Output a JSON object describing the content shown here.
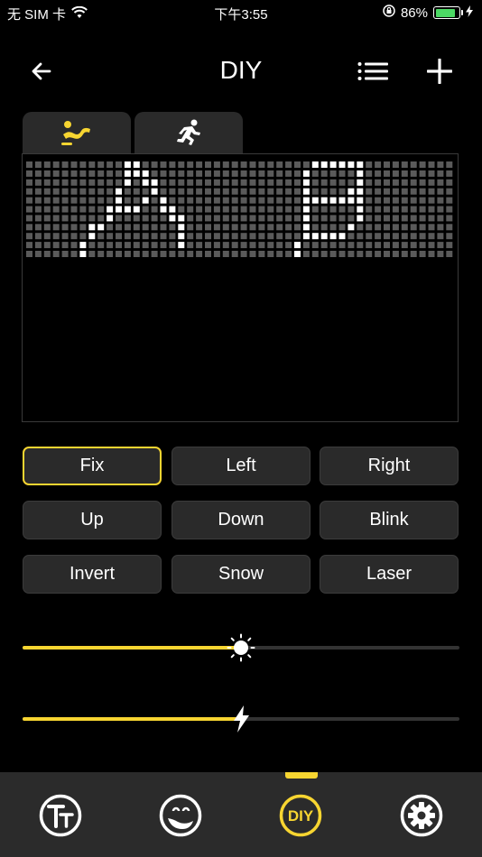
{
  "status_bar": {
    "carrier": "无 SIM 卡",
    "time": "下午3:55",
    "battery": "86%",
    "battery_level": 0.86
  },
  "nav": {
    "title": "DIY"
  },
  "tabs": [
    {
      "icon": "lying-figure-icon",
      "active": true
    },
    {
      "icon": "running-figure-icon",
      "active": false
    }
  ],
  "effects": [
    "Fix",
    "Left",
    "Right",
    "Up",
    "Down",
    "Blink",
    "Invert",
    "Snow",
    "Laser"
  ],
  "active_effect": "Fix",
  "sliders": {
    "brightness": {
      "icon": "sun-icon",
      "value": 0.5
    },
    "speed": {
      "icon": "lightning-icon",
      "value": 0.5
    }
  },
  "tab_bar": [
    {
      "icon": "text-icon",
      "active": false
    },
    {
      "icon": "emoji-icon",
      "active": false
    },
    {
      "icon": "diy-icon",
      "label": "DIY",
      "active": true
    },
    {
      "icon": "settings-icon",
      "active": false
    }
  ],
  "colors": {
    "accent": "#f7d531",
    "button_bg": "#2a2a2a",
    "led_off": "#5a5a5a",
    "led_on": "#ffffff"
  }
}
